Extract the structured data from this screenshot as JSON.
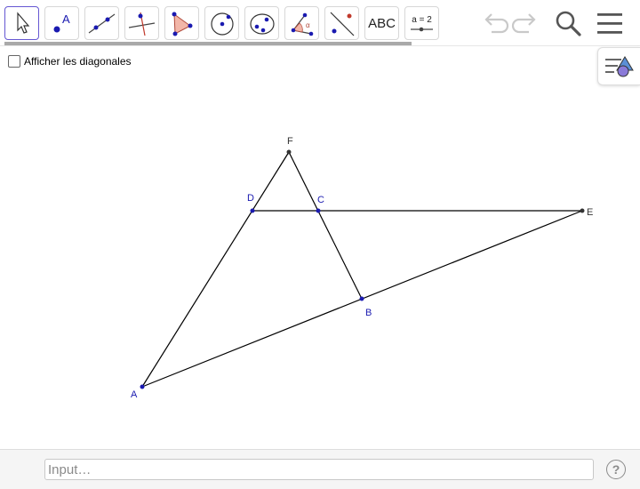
{
  "toolbar": {
    "tools": [
      {
        "name": "move-tool",
        "icon": "cursor-arrow-icon"
      },
      {
        "name": "point-tool",
        "icon": "point-icon",
        "label": "A"
      },
      {
        "name": "line-tool",
        "icon": "line-through-points-icon"
      },
      {
        "name": "perpendicular-line-tool",
        "icon": "perpendicular-line-icon"
      },
      {
        "name": "polygon-tool",
        "icon": "polygon-icon"
      },
      {
        "name": "circle-tool",
        "icon": "circle-center-point-icon"
      },
      {
        "name": "ellipse-tool",
        "icon": "ellipse-icon"
      },
      {
        "name": "angle-tool",
        "icon": "angle-icon",
        "label": "α"
      },
      {
        "name": "reflect-tool",
        "icon": "reflect-about-line-icon"
      },
      {
        "name": "text-tool",
        "icon": "text-icon",
        "label": "ABC"
      },
      {
        "name": "slider-tool",
        "icon": "slider-icon",
        "label": "a = 2"
      }
    ],
    "undo_icon": "undo-icon",
    "redo_icon": "redo-icon",
    "search_icon": "search-icon",
    "menu_icon": "hamburger-menu-icon"
  },
  "checkbox": {
    "label": "Afficher les diagonales",
    "checked": false
  },
  "stylebar_icon": "style-bar-toggle-icon",
  "geometry": {
    "points": [
      {
        "name": "A",
        "color": "#1a1ab0"
      },
      {
        "name": "B",
        "color": "#1a1ab0"
      },
      {
        "name": "C",
        "color": "#1a1ab0"
      },
      {
        "name": "D",
        "color": "#1a1ab0"
      },
      {
        "name": "E",
        "color": "#333333"
      },
      {
        "name": "F",
        "color": "#333333"
      }
    ],
    "segments": [
      "AF",
      "FB",
      "AE",
      "DE"
    ]
  },
  "input_bar": {
    "placeholder": "Input…",
    "help_icon": "help-icon",
    "help_label": "?"
  },
  "colors": {
    "selected_tool_border": "#6557d2",
    "point_blue": "#1a1ab0",
    "point_dark": "#333333"
  }
}
